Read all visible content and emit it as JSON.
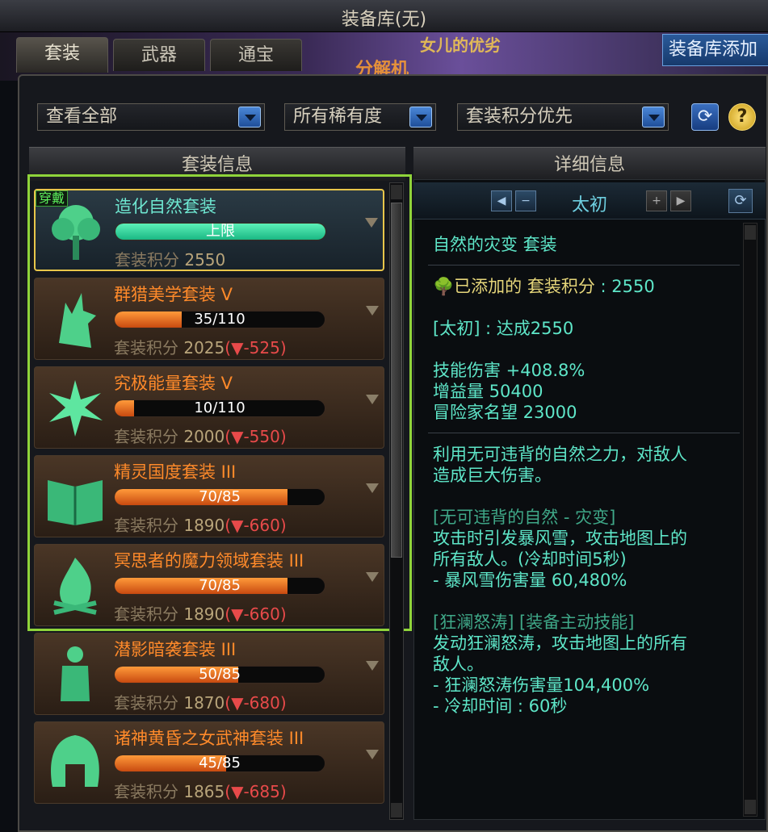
{
  "window": {
    "title": "装备库(无)"
  },
  "tabs": [
    {
      "label": "套装",
      "active": true
    },
    {
      "label": "武器",
      "active": false
    },
    {
      "label": "通宝",
      "active": false
    }
  ],
  "add_button": {
    "label": "装备库添加"
  },
  "background_text": {
    "t1": "女儿的优劣",
    "t2": "分解机"
  },
  "filters": {
    "view": {
      "selected": "查看全部"
    },
    "rarity": {
      "selected": "所有稀有度"
    },
    "sort": {
      "selected": "套装积分优先"
    }
  },
  "left_panel": {
    "header": "套装信息"
  },
  "right_panel": {
    "header": "详细信息",
    "tier": "太初"
  },
  "sets": [
    {
      "icon": "tree-icon",
      "name": "造化自然套装",
      "progress_text": "上限",
      "progress_fraction": 1.0,
      "score_label": "套装积分",
      "score": "2550",
      "diff": "",
      "equipped_badge": "穿戴",
      "selected": true,
      "name_color": "#6ee6d0"
    },
    {
      "icon": "wolf-icon",
      "name": "群猎美学套装 V",
      "progress_text": "35/110",
      "progress_fraction": 0.318,
      "score_label": "套装积分",
      "score": "2025",
      "diff": "▼-525",
      "name_color": "#ff8a2a"
    },
    {
      "icon": "energy-burst-icon",
      "name": "究极能量套装 V",
      "progress_text": "10/110",
      "progress_fraction": 0.091,
      "score_label": "套装积分",
      "score": "2000",
      "diff": "▼-550",
      "name_color": "#ff8a2a"
    },
    {
      "icon": "book-icon",
      "name": "精灵国度套装 III",
      "progress_text": "70/85",
      "progress_fraction": 0.824,
      "score_label": "套装积分",
      "score": "1890",
      "diff": "▼-660",
      "name_color": "#ff8a2a"
    },
    {
      "icon": "flame-icon",
      "name": "冥思者的魔力领域套装 III",
      "progress_text": "70/85",
      "progress_fraction": 0.824,
      "score_label": "套装积分",
      "score": "1890",
      "diff": "▼-660",
      "name_color": "#ff8a2a"
    },
    {
      "icon": "shadow-figure-icon",
      "name": "潜影暗袭套装 III",
      "progress_text": "50/85",
      "progress_fraction": 0.588,
      "score_label": "套装积分",
      "score": "1870",
      "diff": "▼-680",
      "name_color": "#ff8a2a"
    },
    {
      "icon": "helmet-icon",
      "name": "诸神黄昏之女武神套装 III",
      "progress_text": "45/85",
      "progress_fraction": 0.529,
      "score_label": "套装积分",
      "score": "1865",
      "diff": "▼-685",
      "name_color": "#ff8a2a"
    }
  ],
  "detail": {
    "set_title": "自然的灾变 套装",
    "added_label": "已添加的",
    "score_label": "套装积分",
    "score_value": ": 2550",
    "achieved": "[太初] : 达成2550",
    "stats": [
      "技能伤害 +408.8%",
      "增益量 50400",
      "冒险家名望 23000"
    ],
    "desc": [
      "利用无可违背的自然之力，对敌人",
      "造成巨大伤害。"
    ],
    "skill1": [
      "[无可违背的自然 - 灾变]",
      "攻击时引发暴风雪，攻击地图上的",
      "所有敌人。(冷却时间5秒)",
      "- 暴风雪伤害量 60,480%"
    ],
    "skill2": [
      "[狂澜怒涛] [装备主动技能]",
      "发动狂澜怒涛，攻击地图上的所有",
      "敌人。",
      "- 狂澜怒涛伤害量104,400%",
      "- 冷却时间 : 60秒"
    ]
  }
}
